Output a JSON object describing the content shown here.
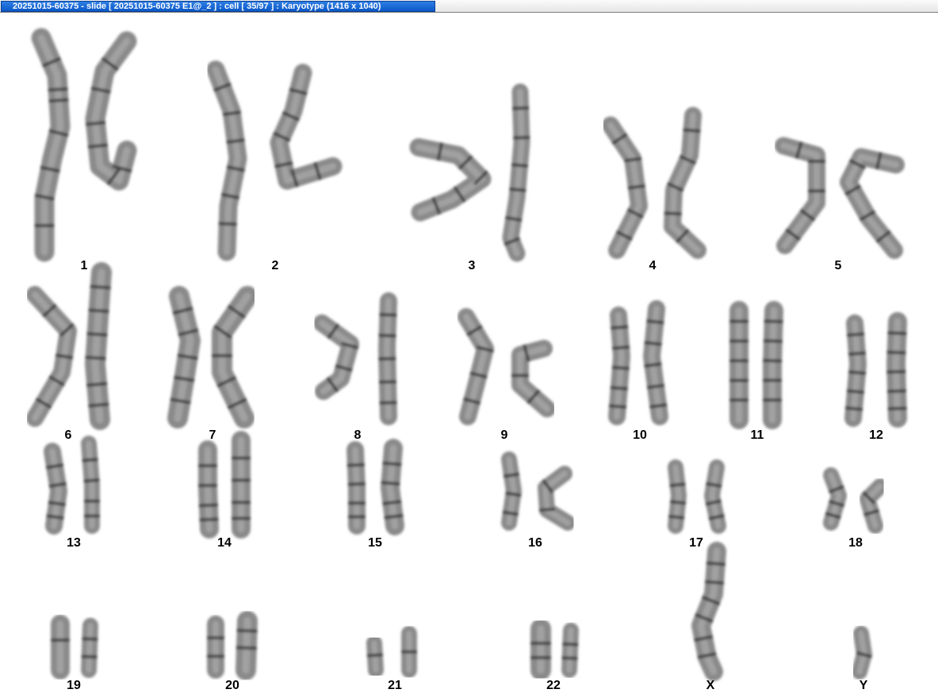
{
  "window": {
    "title": "20251015-60375 - slide [ 20251015-60375 E1@_2 ] : cell [ 35/97 ] : Karyotype  (1416 x 1040)"
  },
  "karyotype": {
    "labels": [
      "1",
      "2",
      "3",
      "4",
      "5",
      "6",
      "7",
      "8",
      "9",
      "10",
      "11",
      "12",
      "13",
      "14",
      "15",
      "16",
      "17",
      "18",
      "19",
      "20",
      "21",
      "22",
      "X",
      "Y"
    ]
  },
  "colors": {
    "title_bar": "#0b59c9",
    "title_text": "#ffffff",
    "chromosome": "#8a8a8a",
    "band": "#2a2a2a"
  }
}
